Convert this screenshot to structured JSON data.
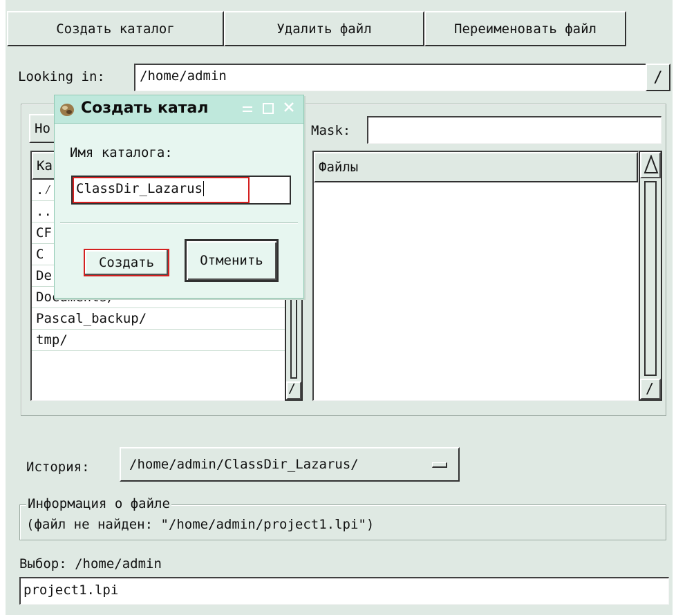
{
  "toolbar": {
    "create_dir": "Создать каталог",
    "delete_file": "Удалить файл",
    "rename_file": "Переименовать файл"
  },
  "looking_in": {
    "label": "Looking in:",
    "value": "/home/admin",
    "dropdown_icon": "chevron-down-icon"
  },
  "filter": {
    "home_button_partial": "Ho",
    "mask_label": "Mask:",
    "mask_value": ""
  },
  "dirs": {
    "header_partial": "Ka",
    "items": [
      ".⁄",
      "..",
      "CF",
      "C",
      "De",
      "Documents/",
      "Pascal_backup/",
      "tmp/"
    ]
  },
  "files": {
    "header": "Файлы"
  },
  "history": {
    "label": "История:",
    "value": "/home/admin/ClassDir_Lazarus/"
  },
  "file_info": {
    "legend": "Информация о файле",
    "text": "(файл не найден: \"/home/admin/project1.lpi\")"
  },
  "selection": {
    "label": "Выбор: /home/admin",
    "value": "project1.lpi"
  },
  "dialog": {
    "title": "Создать катал",
    "field_label": "Имя каталога:",
    "field_value": "ClassDir_Lazarus",
    "create_button": "Создать",
    "cancel_button": "Отменить",
    "icons": [
      "app-icon",
      "minimize-icon",
      "maximize-icon",
      "close-icon"
    ]
  },
  "colors": {
    "window_bg": "#dfe9e3",
    "dialog_bg": "#e7f6f0",
    "titlebar_bg": "#bfe8dc",
    "focus_red": "#d42020"
  }
}
